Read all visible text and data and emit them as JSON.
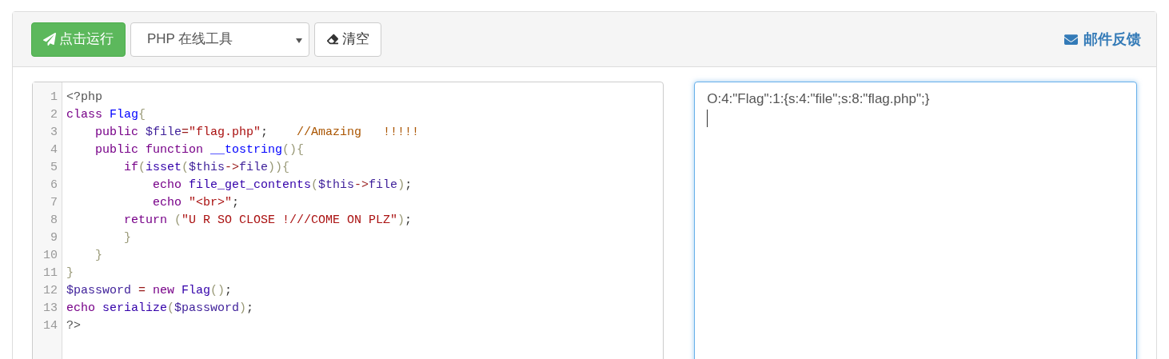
{
  "toolbar": {
    "run_button": "点击运行",
    "language_select": {
      "value": "PHP 在线工具"
    },
    "clear_button": "清空",
    "feedback_link": "邮件反馈"
  },
  "editor": {
    "lines": [
      {
        "number": "1",
        "tokens": [
          {
            "kind": "meta",
            "text": "<?php"
          }
        ]
      },
      {
        "number": "2",
        "tokens": [
          {
            "kind": "keyword",
            "text": "class "
          },
          {
            "kind": "def",
            "text": "Flag"
          },
          {
            "kind": "bracket",
            "text": "{"
          }
        ]
      },
      {
        "number": "3",
        "tokens": [
          {
            "kind": "keyword",
            "text": "    public "
          },
          {
            "kind": "variable",
            "text": "$file"
          },
          {
            "kind": "operator",
            "text": "="
          },
          {
            "kind": "string",
            "text": "\"flag.php\""
          },
          {
            "kind": "plain",
            "text": ";    "
          },
          {
            "kind": "comment",
            "text": "//Amazing   !!!!!"
          }
        ]
      },
      {
        "number": "4",
        "tokens": [
          {
            "kind": "keyword",
            "text": "    public function "
          },
          {
            "kind": "def",
            "text": "__tostring"
          },
          {
            "kind": "bracket",
            "text": "(){"
          }
        ]
      },
      {
        "number": "5",
        "tokens": [
          {
            "kind": "keyword",
            "text": "        if"
          },
          {
            "kind": "bracket",
            "text": "("
          },
          {
            "kind": "builtin",
            "text": "isset"
          },
          {
            "kind": "bracket",
            "text": "("
          },
          {
            "kind": "variable",
            "text": "$this"
          },
          {
            "kind": "operator",
            "text": "->"
          },
          {
            "kind": "variable",
            "text": "file"
          },
          {
            "kind": "bracket",
            "text": ")){"
          }
        ]
      },
      {
        "number": "6",
        "tokens": [
          {
            "kind": "keyword",
            "text": "            echo "
          },
          {
            "kind": "builtin",
            "text": "file_get_contents"
          },
          {
            "kind": "bracket",
            "text": "("
          },
          {
            "kind": "variable",
            "text": "$this"
          },
          {
            "kind": "operator",
            "text": "->"
          },
          {
            "kind": "variable",
            "text": "file"
          },
          {
            "kind": "bracket",
            "text": ")"
          },
          {
            "kind": "plain",
            "text": ";"
          }
        ]
      },
      {
        "number": "7",
        "tokens": [
          {
            "kind": "keyword",
            "text": "            echo "
          },
          {
            "kind": "string",
            "text": "\"<br>\""
          },
          {
            "kind": "plain",
            "text": ";"
          }
        ]
      },
      {
        "number": "8",
        "tokens": [
          {
            "kind": "keyword",
            "text": "        return "
          },
          {
            "kind": "bracket",
            "text": "("
          },
          {
            "kind": "string",
            "text": "\"U R SO CLOSE !///COME ON PLZ\""
          },
          {
            "kind": "bracket",
            "text": ")"
          },
          {
            "kind": "plain",
            "text": ";"
          }
        ]
      },
      {
        "number": "9",
        "tokens": [
          {
            "kind": "bracket",
            "text": "        }"
          }
        ]
      },
      {
        "number": "10",
        "tokens": [
          {
            "kind": "bracket",
            "text": "    }"
          }
        ]
      },
      {
        "number": "11",
        "tokens": [
          {
            "kind": "bracket",
            "text": "}"
          }
        ]
      },
      {
        "number": "12",
        "tokens": [
          {
            "kind": "variable",
            "text": "$password "
          },
          {
            "kind": "operator",
            "text": "= "
          },
          {
            "kind": "keyword",
            "text": "new "
          },
          {
            "kind": "builtin",
            "text": "Flag"
          },
          {
            "kind": "bracket",
            "text": "()"
          },
          {
            "kind": "plain",
            "text": ";"
          }
        ]
      },
      {
        "number": "13",
        "tokens": [
          {
            "kind": "keyword",
            "text": "echo "
          },
          {
            "kind": "builtin",
            "text": "serialize"
          },
          {
            "kind": "bracket",
            "text": "("
          },
          {
            "kind": "variable",
            "text": "$password"
          },
          {
            "kind": "bracket",
            "text": ")"
          },
          {
            "kind": "plain",
            "text": ";"
          }
        ]
      },
      {
        "number": "14",
        "tokens": [
          {
            "kind": "meta",
            "text": "?>"
          }
        ]
      }
    ]
  },
  "output": {
    "value": "O:4:\"Flag\":1:{s:4:\"file\";s:8:\"flag.php\";}"
  }
}
